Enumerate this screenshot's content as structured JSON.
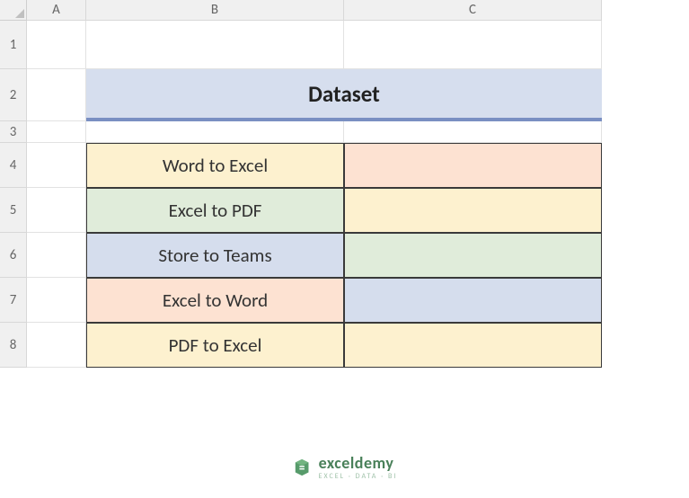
{
  "columns": {
    "corner": "",
    "A": "A",
    "B": "B",
    "C": "C"
  },
  "rows": {
    "r1": "1",
    "r2": "2",
    "r3": "3",
    "r4": "4",
    "r5": "5",
    "r6": "6",
    "r7": "7",
    "r8": "8"
  },
  "title": "Dataset",
  "table": {
    "rows": [
      {
        "b": "Word to Excel",
        "c": ""
      },
      {
        "b": "Excel to PDF",
        "c": ""
      },
      {
        "b": "Store to Teams",
        "c": ""
      },
      {
        "b": "Excel to Word",
        "c": ""
      },
      {
        "b": "PDF to Excel",
        "c": ""
      }
    ]
  },
  "watermark": {
    "name": "exceldemy",
    "tagline": "EXCEL · DATA · BI"
  },
  "colors": {
    "peach": "#fde2d2",
    "cream": "#fdf1cf",
    "green": "#e0ecda",
    "blue": "#d5dded",
    "grey": "#e6e6e6",
    "banner_bg": "#d6deee",
    "banner_rule": "#7a8fc2"
  }
}
